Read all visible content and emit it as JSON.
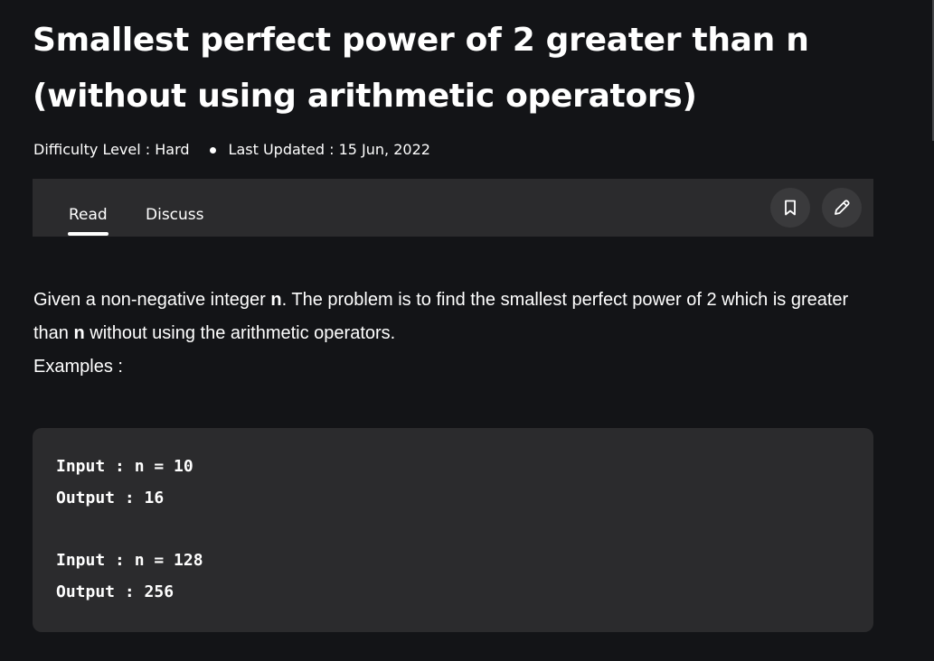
{
  "article": {
    "title": "Smallest perfect power of 2 greater than n (without using arithmetic operators)",
    "difficulty": "Difficulty Level : Hard",
    "last_updated": "Last Updated : 15 Jun, 2022"
  },
  "tabs": {
    "read": "Read",
    "discuss": "Discuss",
    "active": "Read"
  },
  "actions": {
    "bookmark_icon": "bookmark-icon",
    "edit_icon": "pencil-icon"
  },
  "content": {
    "p1_before": "Given a non-negative integer ",
    "p1_bold": "n",
    "p1_middle": ". The problem is to find the smallest perfect power of 2 which is greater than ",
    "p1_bold2": "n",
    "p1_after": " without using the arithmetic operators.",
    "examples_label": "Examples :"
  },
  "code_example": {
    "lines": [
      "Input : n = 10",
      "Output : 16",
      "",
      "Input : n = 128",
      "Output : 256"
    ]
  },
  "colors": {
    "background": "#131417",
    "panel": "#2b2b2d",
    "icon_button": "#3a3a3c",
    "text": "#ffffff"
  }
}
